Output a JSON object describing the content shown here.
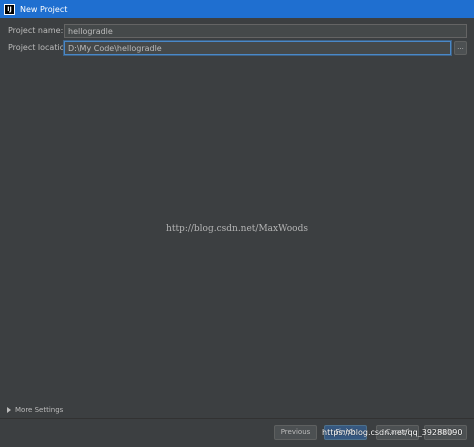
{
  "window": {
    "title": "New Project",
    "icon_name": "intellij-app-icon",
    "icon_glyph": "IJ",
    "accent_color": "#1f6fd0"
  },
  "form": {
    "project_name": {
      "label": "Project name:",
      "value": "hellogradle"
    },
    "project_location": {
      "label": "Project location:",
      "value": "D:\\My Code\\hellogradle",
      "browse_label": "..."
    }
  },
  "watermark": {
    "center": "http://blog.csdn.net/MaxWoods",
    "bottom": "https://blog.csdn.net/qq_39288090"
  },
  "more_settings": {
    "label": "More Settings",
    "icon_name": "chevron-right-icon"
  },
  "buttons": {
    "previous": "Previous",
    "finish": "Finish",
    "cancel": "Cancel",
    "help": "Help"
  }
}
